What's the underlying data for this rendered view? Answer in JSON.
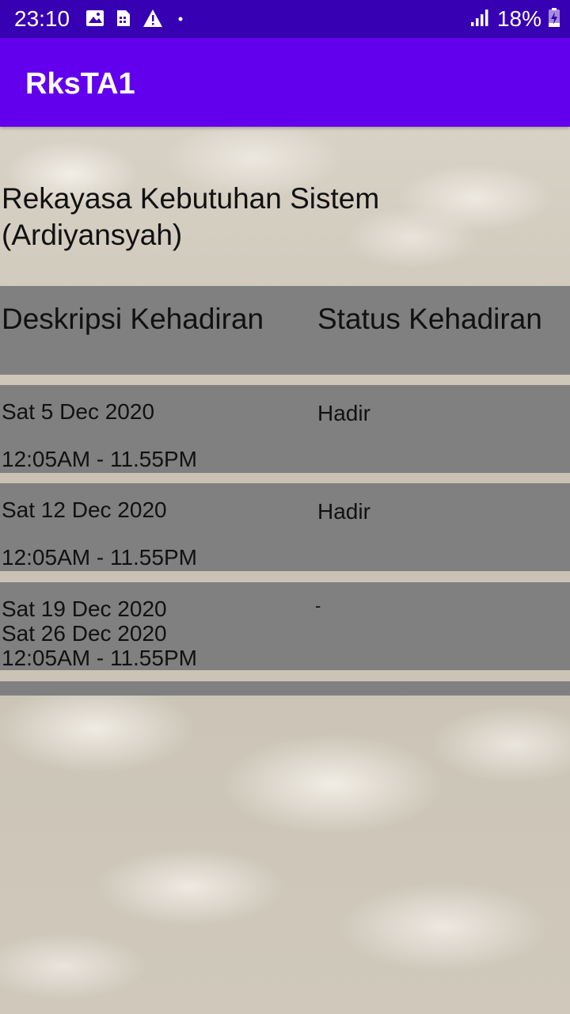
{
  "status_bar": {
    "time": "23:10",
    "left_icons": [
      "image-icon",
      "sim-card-icon",
      "warning-icon",
      "dot-icon"
    ],
    "right_icons": [
      "signal-icon",
      "battery-charging-icon"
    ],
    "battery_percent": "18%"
  },
  "app_bar": {
    "title": "RksTA1"
  },
  "course": {
    "title_line1": "Rekayasa Kebutuhan Sistem",
    "title_line2": "(Ardiyansyah)"
  },
  "table": {
    "headers": {
      "description": "Deskripsi Kehadiran",
      "status": "Status Kehadiran"
    },
    "rows": [
      {
        "date": "Sat 5 Dec 2020",
        "time": "12:05AM - 11.55PM",
        "status": "Hadir"
      },
      {
        "date": "Sat 12 Dec 2020",
        "time": "12:05AM - 11.55PM",
        "status": "Hadir"
      },
      {
        "date": "Sat 19 Dec 2020",
        "date2": "Sat 26 Dec 2020",
        "time": "12:05AM - 11.55PM",
        "status": "-"
      }
    ]
  },
  "colors": {
    "status_bar": "#3700b3",
    "app_bar": "#6200ee",
    "row_band": "#808080"
  }
}
